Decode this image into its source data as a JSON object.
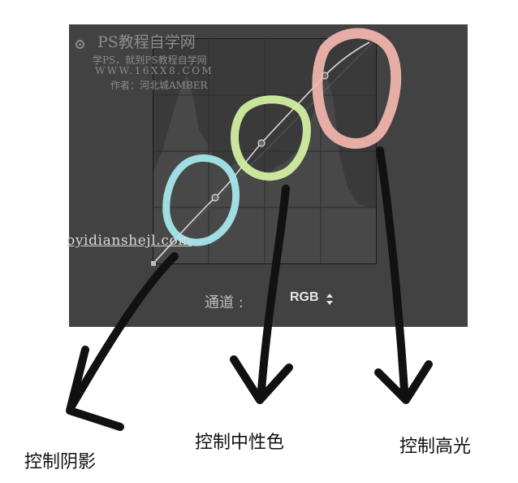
{
  "watermark": {
    "title": "PS教程自学网",
    "line2": "学PS，就到PS教程自学网",
    "line3": "WWW.16XX8.COM",
    "line4": "作者：河北城AMBER",
    "url": "oyidianshejl.com"
  },
  "curves_panel": {
    "channel_label": "通道 :",
    "channel_value": "RGB",
    "icons": [
      "eye-target-icon",
      "updown-arrow-icon"
    ]
  },
  "annotations": {
    "shadows": {
      "label": "控制阴影",
      "circle_color": "#a8ecf2"
    },
    "midtones": {
      "label": "控制中性色",
      "circle_color": "#d6f4a4"
    },
    "highlights": {
      "label": "控制高光",
      "circle_color": "#f4b7b0"
    },
    "arrow_color": "#111111"
  },
  "colors": {
    "panel_bg": "#424242",
    "graph_bg": "#3a3a3a",
    "curve": "#d8d8d8"
  }
}
